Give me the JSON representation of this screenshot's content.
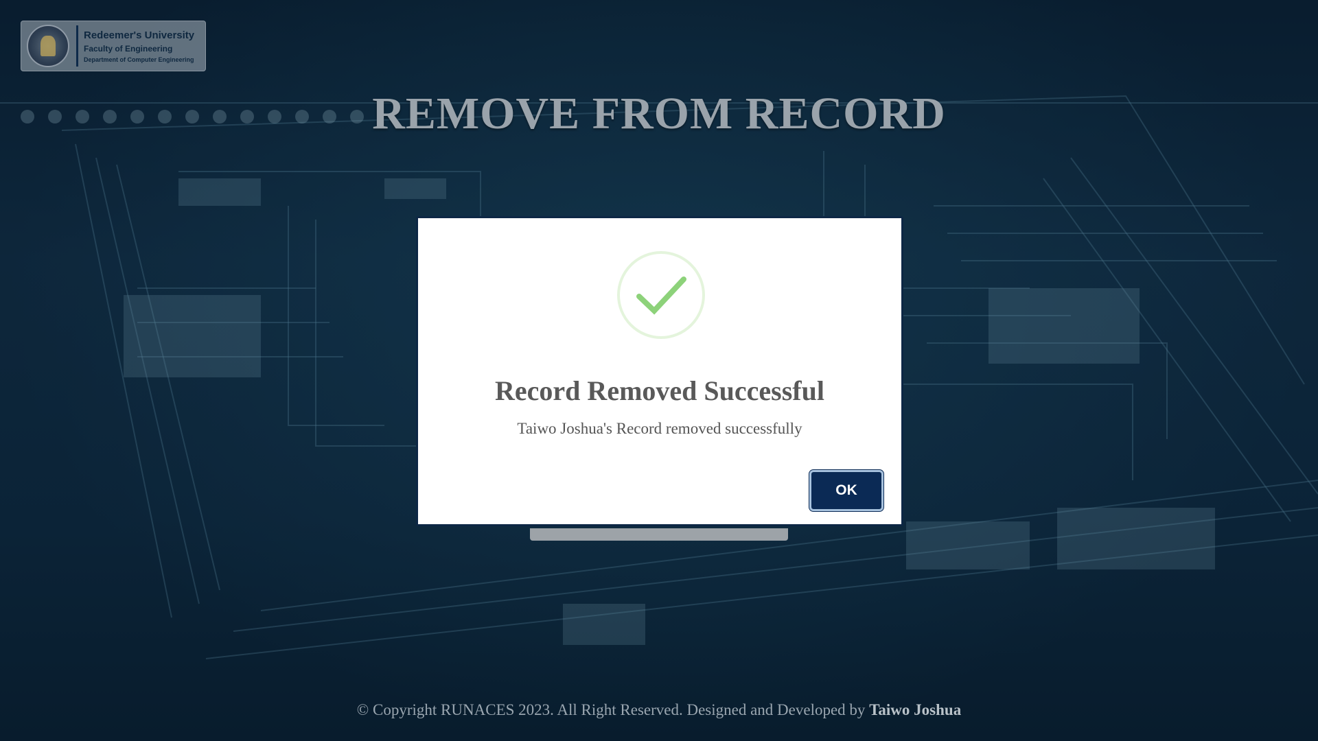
{
  "logo": {
    "university": "Redeemer's University",
    "faculty": "Faculty of Engineering",
    "department": "Department of Computer Engineering"
  },
  "page": {
    "title": "REMOVE FROM RECORD"
  },
  "modal": {
    "icon": "check-icon",
    "title": "Record Removed Successful",
    "message": "Taiwo Joshua's Record removed successfully",
    "ok_label": "OK",
    "accent_color": "#0b2a55",
    "icon_color": "#8dd27a"
  },
  "footer": {
    "text": "© Copyright RUNACES 2023. All Right Reserved. Designed and Developed by ",
    "author": "Taiwo Joshua"
  }
}
